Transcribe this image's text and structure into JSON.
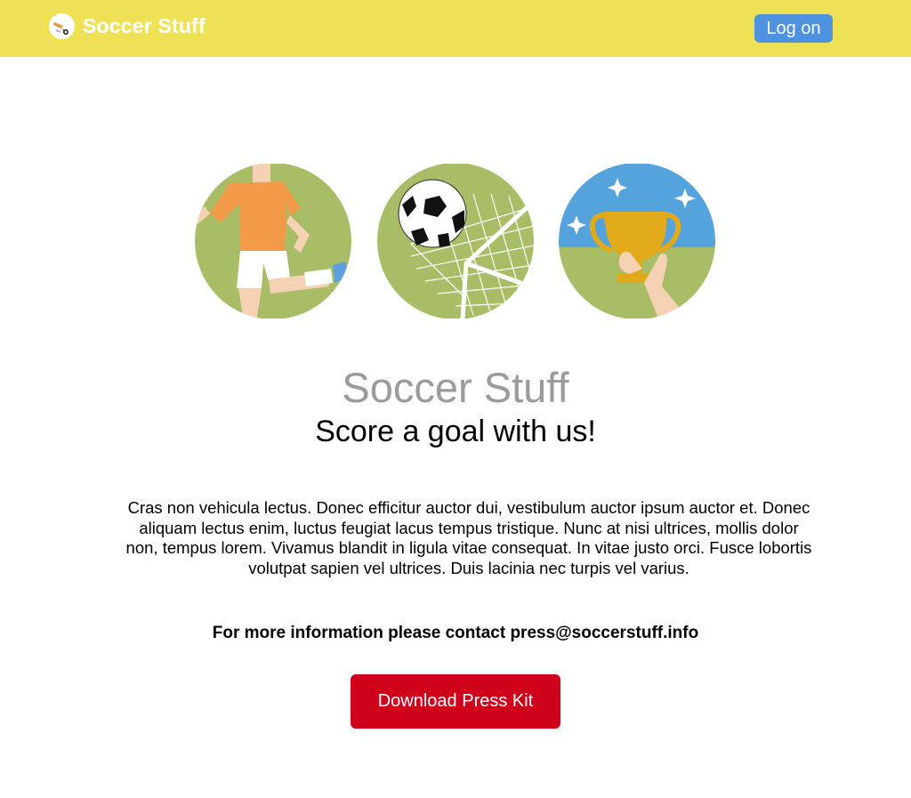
{
  "header": {
    "brand_name": "Soccer Stuff",
    "login_label": "Log on"
  },
  "hero": {
    "illustrations": [
      "soccer-player-kick-icon",
      "ball-in-net-icon",
      "trophy-icon"
    ],
    "title": "Soccer Stuff",
    "subtitle": "Score a goal with us!"
  },
  "content": {
    "paragraph": "Cras non vehicula lectus. Donec efficitur auctor dui, vestibulum auctor ipsum auctor et. Donec aliquam lectus enim, luctus feugiat lacus tempus tristique. Nunc at nisi ultrices, mollis dolor non, tempus lorem. Vivamus blandit in ligula vitae consequat. In vitae justo orci. Fusce lobortis volutpat sapien vel ultrices. Duis lacinia nec turpis vel varius.",
    "contact": "For more information please contact press@soccerstuff.info",
    "download_label": "Download Press Kit"
  },
  "colors": {
    "topbar": "#efe256",
    "login_button": "#4f92df",
    "download_button": "#d0021b",
    "title": "#9b9b9b",
    "circle_green": "#a8bd65",
    "sky_blue": "#55a3dc"
  }
}
